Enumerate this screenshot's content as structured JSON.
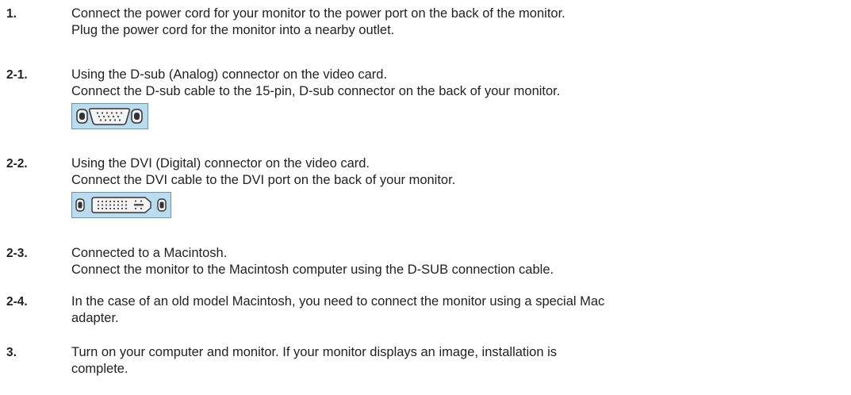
{
  "steps": [
    {
      "number": "1.",
      "lines": [
        "Connect the power cord for your monitor to the power port on the back of the monitor.",
        "Plug the power cord for the monitor into a nearby outlet."
      ]
    },
    {
      "number": "2-1.",
      "lines": [
        "Using the D-sub (Analog) connector on the video card.",
        "Connect the D-sub cable to the 15-pin, D-sub connector on the back of your monitor."
      ],
      "icon": "d-sub-port-icon"
    },
    {
      "number": "2-2.",
      "lines": [
        "Using the DVI (Digital) connector on the video card.",
        "Connect the DVI cable to the DVI port on the back of your monitor."
      ],
      "icon": "dvi-port-icon"
    },
    {
      "number": "2-3.",
      "lines": [
        "Connected to a Macintosh.",
        "Connect the monitor to the Macintosh computer using the D-SUB connection cable."
      ]
    },
    {
      "number": "2-4.",
      "lines": [
        "In the case of an old model Macintosh, you need to connect the monitor using a special Mac",
        "adapter."
      ]
    },
    {
      "number": "3.",
      "lines": [
        "Turn on your computer and monitor. If your monitor displays an image, installation is",
        "complete."
      ]
    }
  ],
  "colors": {
    "text": "#222222",
    "port_background": "#b9dcef",
    "port_border": "#6c95ad"
  }
}
